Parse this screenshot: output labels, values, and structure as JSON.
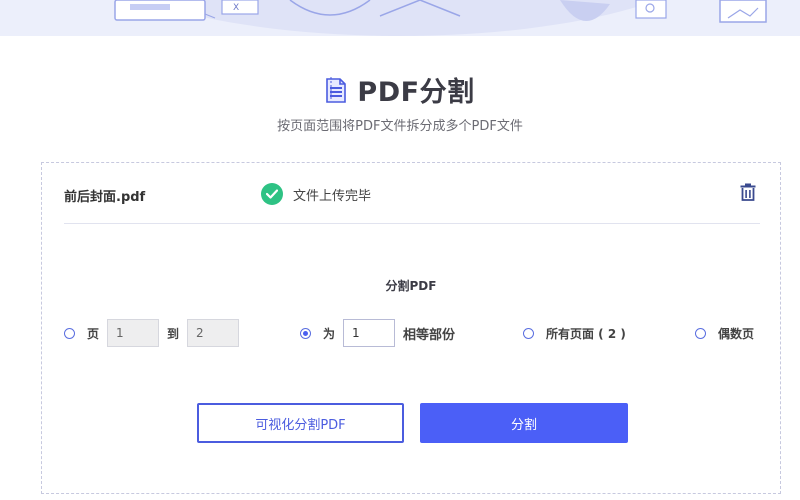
{
  "header": {
    "title": "PDF分割",
    "subtitle": "按页面范围将PDF文件拆分成多个PDF文件",
    "icon": "pdf-document-icon"
  },
  "file": {
    "name": "前后封面.pdf",
    "status": "文件上传完毕",
    "status_icon": "check-circle-icon",
    "delete_icon": "trash-icon"
  },
  "split": {
    "label": "分割PDF",
    "options": {
      "range": {
        "label_page": "页",
        "from": "1",
        "label_to": "到",
        "to": "2",
        "selected": false
      },
      "equal": {
        "label_as": "为",
        "count": "1",
        "label_parts": "相等部份",
        "selected": true
      },
      "all": {
        "label": "所有页面 ( 2 )",
        "selected": false
      },
      "even": {
        "label": "偶数页",
        "selected": false
      }
    }
  },
  "buttons": {
    "visual": "可视化分割PDF",
    "split": "分割"
  },
  "colors": {
    "accent": "#4b5ff7",
    "success": "#2ec284",
    "banner": "#eceffb"
  }
}
